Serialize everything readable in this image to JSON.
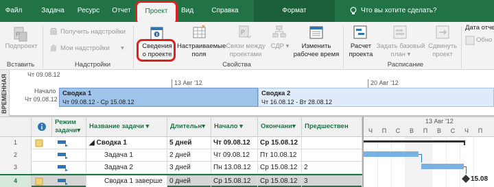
{
  "tabs": [
    {
      "label": "Файл"
    },
    {
      "label": "Задача"
    },
    {
      "label": "Ресурс"
    },
    {
      "label": "Отчет"
    },
    {
      "label": "Проект"
    },
    {
      "label": "Вид"
    },
    {
      "label": "Справка"
    },
    {
      "label": "Формат"
    }
  ],
  "tell_me": "Что вы хотите сделать?",
  "colors": {
    "brand": "#217346",
    "highlight_ring": "#e02020",
    "summary_bar": "#9ec4ea",
    "task_bar": "#7ab0e4"
  },
  "ribbon": {
    "subproject": "Подпроект",
    "get_addins": "Получить надстройки",
    "my_addins": "Мои надстройки",
    "project_info": [
      "Сведения",
      "о проекте"
    ],
    "custom_fields": [
      "Настраиваемые",
      "поля"
    ],
    "links_between": [
      "Связи между",
      "проектами"
    ],
    "wbs": "СДР",
    "change_work_time": [
      "Изменить",
      "рабочее время"
    ],
    "calc_project": [
      "Расчет",
      "проекта"
    ],
    "set_baseline": [
      "Задать базовый",
      "план"
    ],
    "move_project": [
      "Сдвинуть",
      "проект"
    ],
    "status_date": "Дата отче",
    "update": "Обно",
    "groups": {
      "insert": "Вставить",
      "addins": "Надстройки",
      "properties": "Свойства",
      "schedule": "Расписание"
    }
  },
  "timeline": {
    "side_label": "ВРЕМЕННАЯ",
    "top_date": "Чт 09.08.12",
    "start_label": "Начало",
    "start_date": "Чт 09.08.12",
    "tick1": "13 Авг '12",
    "tick2": "20 Авг '12",
    "bars": [
      {
        "title": "Сводка 1",
        "dates": "Чт 09.08.12 - Ср 15.08.12"
      },
      {
        "title": "Сводка 2",
        "dates": "Чт 16.08.12 - Вт 28.08.12"
      }
    ]
  },
  "grid": {
    "headers": {
      "mode": [
        "Режим",
        "задачи"
      ],
      "name": "Название задачи",
      "duration": "Длительн",
      "start": "Начало",
      "finish": "Окончани",
      "pred": "Предшествен"
    },
    "rows": [
      {
        "num": "1",
        "name": "◢ Сводка 1",
        "duration": "5 дней",
        "start": "Чт 09.08.12",
        "finish": "Ср 15.08.12",
        "pred": "",
        "summary": true
      },
      {
        "num": "2",
        "name": "Задача 1",
        "duration": "2 дней",
        "start": "Чт 09.08.12",
        "finish": "Пт 10.08.12",
        "pred": "",
        "summary": false
      },
      {
        "num": "3",
        "name": "Задача 2",
        "duration": "3 дней",
        "start": "Пн 13.08.12",
        "finish": "Ср 15.08.12",
        "pred": "2",
        "summary": false
      },
      {
        "num": "4",
        "name": "Сводка 1 заверше",
        "duration": "0 дней",
        "start": "Ср 15.08.12",
        "finish": "Ср 15.08.12",
        "pred": "3",
        "summary": false
      }
    ]
  },
  "gantt": {
    "week_label": "13 Авг '12",
    "days": [
      "Ч",
      "П",
      "С",
      "В",
      "П",
      "В",
      "С",
      "Ч",
      "П"
    ],
    "milestone_label": "15.08"
  }
}
